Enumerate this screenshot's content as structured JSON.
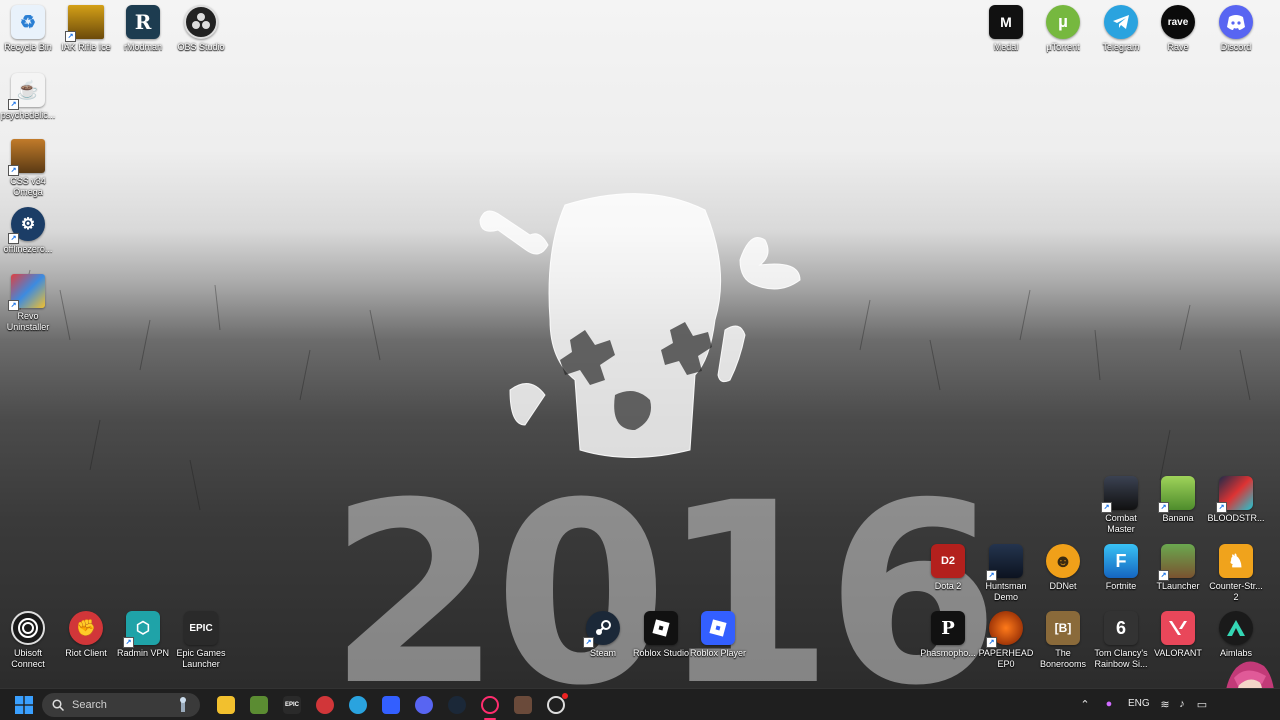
{
  "desktop_icons": {
    "recycle_bin": "Recycle Bin",
    "iak_rifle": "IAK Rifle Ice",
    "rmodman": "rModman",
    "obs": "OBS Studio",
    "psychedelic": "psychedelic...",
    "css_omega": "CSS v34 Omega",
    "offlinezero": "offlinezero...",
    "revo": "Revo Uninstaller",
    "medal": "Medal",
    "utorrent": "µTorrent",
    "telegram": "Telegram",
    "rave": "Rave",
    "discord": "Discord",
    "combat_master": "Combat Master",
    "banana": "Banana",
    "bloodstrike": "BLOODSTR...",
    "dota2": "Dota 2",
    "huntsman": "Huntsman Demo",
    "ddnet": "DDNet",
    "fortnite": "Fortnite",
    "tlauncher": "TLauncher",
    "counter_strike": "Counter-Str... 2",
    "ubisoft": "Ubisoft Connect",
    "riot": "Riot Client",
    "radmin": "Radmin VPN",
    "epic": "Epic Games Launcher",
    "steam": "Steam",
    "roblox_studio": "Roblox Studio",
    "roblox_player": "Roblox Player",
    "phasmophobia": "Phasmopho...",
    "paperhead": "PAPERHEAD EP0",
    "backrooms": "The Bonerooms",
    "rainbow_six": "Tom Clancy's Rainbow Si...",
    "valorant": "VALORANT",
    "aimlabs": "Aimlabs"
  },
  "tile_glyphs": {
    "rmodman": "R",
    "rave": "rave",
    "dota2": "D2",
    "ddnet": "☻",
    "fortnite": "F",
    "epic": "EPIC",
    "backrooms": "[B]",
    "rainbow_six": "6",
    "phasmophobia": "P",
    "riot": "✊"
  },
  "wallpaper": {
    "year": "2016"
  },
  "taskbar": {
    "search_placeholder": "Search",
    "language": "ENG",
    "epic_glyph": "EPIC"
  },
  "colors": {
    "taskbar_bg": "#1f1f1f",
    "windows_blue": "#0a84ff",
    "discord": "#5865f2",
    "telegram": "#2aa3df",
    "utorrent": "#76b83f",
    "valorant": "#e9475a",
    "riot": "#d13639"
  }
}
